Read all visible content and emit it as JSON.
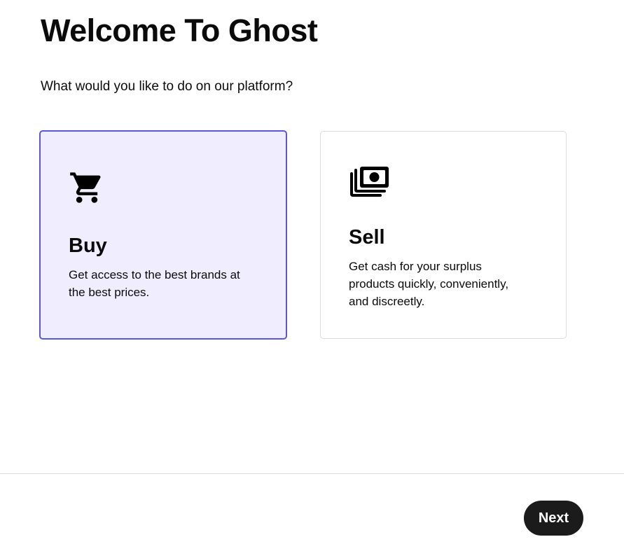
{
  "page": {
    "title": "Welcome To Ghost",
    "subtitle": "What would you like to do on our platform?"
  },
  "options": [
    {
      "heading": "Buy",
      "description": "Get access to the best brands at the best prices.",
      "icon": "shopping-cart-icon",
      "selected": true
    },
    {
      "heading": "Sell",
      "description": "Get cash for your surplus products quickly, conveniently, and discreetly.",
      "icon": "cash-stack-icon",
      "selected": false
    }
  ],
  "footer": {
    "next_label": "Next"
  },
  "colors": {
    "selected_border": "#5b57d8",
    "selected_background": "#f0eefe",
    "button_background": "#1b1b1b",
    "divider": "#dedede"
  }
}
